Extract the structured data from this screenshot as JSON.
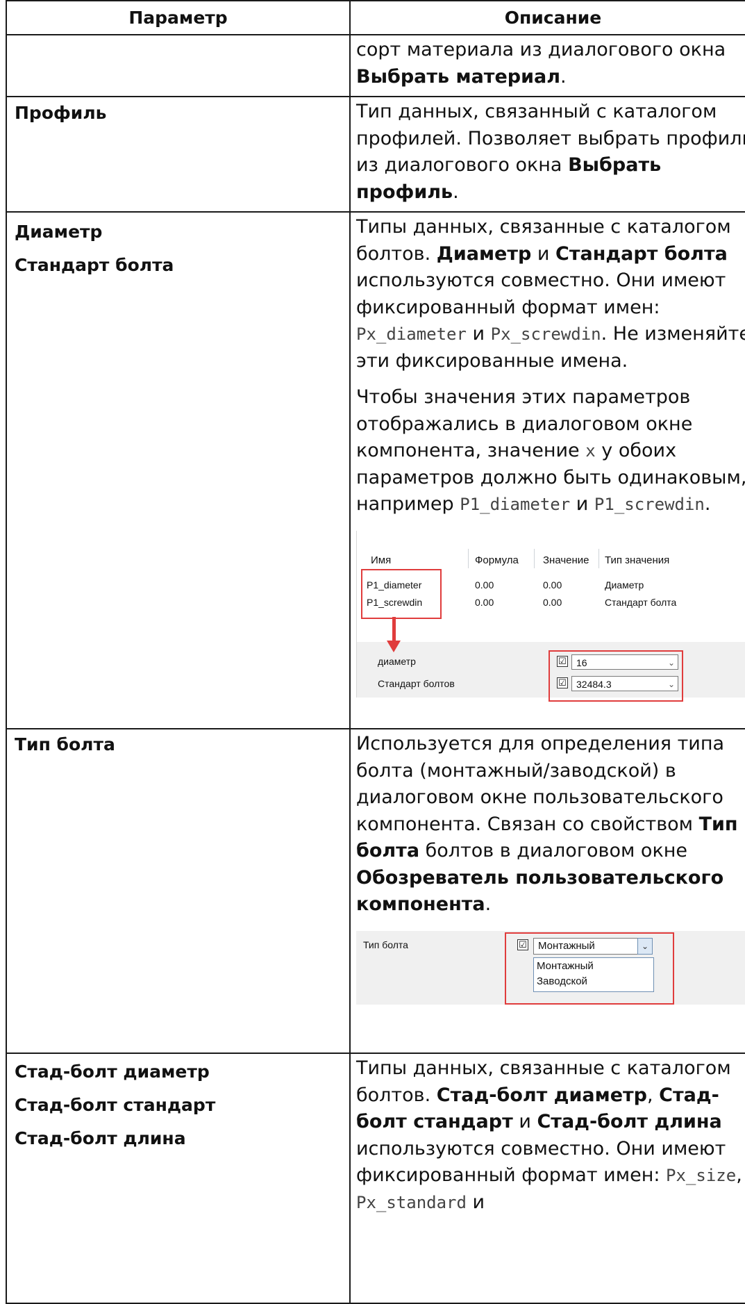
{
  "headers": {
    "param": "Параметр",
    "desc": "Описание"
  },
  "row0": {
    "desc_plain": "сорт материала из диалогового окна ",
    "desc_bold": "Выбрать материал",
    "desc_end": "."
  },
  "row1": {
    "param": "Профиль",
    "desc_plain": "Тип данных, связанный с каталогом профилей. Позволяет выбрать профиль из диалогового окна ",
    "desc_bold": "Выбрать профиль",
    "desc_end": "."
  },
  "row2": {
    "param1": "Диаметр",
    "param2": "Стандарт болта",
    "p1_a": "Типы данных, связанные с каталогом болтов. ",
    "p1_b1": "Диаметр",
    "p1_c": " и ",
    "p1_b2": "Стандарт болта",
    "p1_d": " используются совместно. Они имеют фиксированный формат имен: ",
    "p1_code1": "Px_diameter",
    "p1_e": " и ",
    "p1_code2": "Px_screwdin",
    "p1_f": ". Не изменяйте эти фиксированные имена.",
    "p2_a": "Чтобы значения этих параметров отображались в диалоговом окне компонента, значение ",
    "p2_code0": "x",
    "p2_b": " у обоих параметров должно быть одинаковым, например ",
    "p2_code1": "P1_diameter",
    "p2_c": " и ",
    "p2_code2": "P1_screwdin",
    "p2_d": ".",
    "shot": {
      "col_name": "Имя",
      "col_formula": "Формула",
      "col_value": "Значение",
      "col_type": "Тип значения",
      "rows": [
        {
          "name": "P1_diameter",
          "formula": "0.00",
          "value": "0.00",
          "type": "Диаметр"
        },
        {
          "name": "P1_screwdin",
          "formula": "0.00",
          "value": "0.00",
          "type": "Стандарт болта"
        }
      ],
      "label_diameter": "диаметр",
      "label_standard": "Стандарт болтов",
      "combo1_value": "16",
      "combo2_value": "32484.3",
      "check_mark": "☑",
      "dropdown_arrow": "⌄"
    }
  },
  "row3": {
    "param": "Тип болта",
    "desc_a": "Используется для определения типа болта (монтажный/заводской) в диалоговом окне пользовательского компонента. Связан со свойством ",
    "desc_b1": "Тип болта",
    "desc_c": " болтов в диалоговом окне ",
    "desc_b2": "Обозреватель пользовательского компонента",
    "desc_d": ".",
    "shot": {
      "label": "Тип болта",
      "combo_value": "Монтажный",
      "options": [
        "Монтажный",
        "Заводской"
      ]
    }
  },
  "row4": {
    "param1": "Стад-болт диаметр",
    "param2": "Стад-болт стандарт",
    "param3": "Стад-болт длина",
    "desc_a": "Типы данных, связанные с каталогом болтов. ",
    "desc_b1": "Стад-болт диаметр",
    "desc_c": ", ",
    "desc_b2": "Стад-болт стандарт",
    "desc_d": " и ",
    "desc_b3": "Стад-болт длина",
    "desc_e": " используются совместно. Они имеют фиксированный формат имен: ",
    "desc_code1": "Px_size",
    "desc_f": ", ",
    "desc_code2": "Px_standard",
    "desc_g": " и"
  }
}
